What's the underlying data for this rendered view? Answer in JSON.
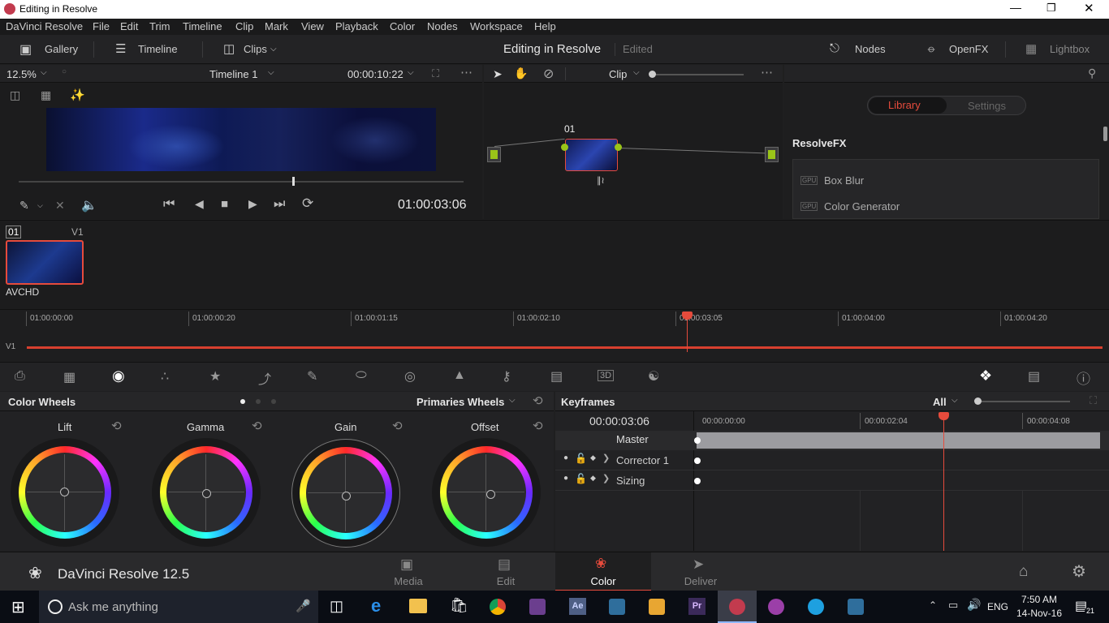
{
  "window": {
    "title": "Editing in Resolve"
  },
  "menu": [
    "DaVinci Resolve",
    "File",
    "Edit",
    "Trim",
    "Timeline",
    "Clip",
    "Mark",
    "View",
    "Playback",
    "Color",
    "Nodes",
    "Workspace",
    "Help"
  ],
  "toolbar": {
    "gallery": "Gallery",
    "timeline": "Timeline",
    "clips": "Clips",
    "project": "Editing in Resolve",
    "status": "Edited",
    "nodes": "Nodes",
    "openfx": "OpenFX",
    "lightbox": "Lightbox"
  },
  "viewer": {
    "zoom": "12.5%",
    "timeline_name": "Timeline 1",
    "duration": "00:00:10:22",
    "timecode": "01:00:03:06"
  },
  "nodegraph": {
    "mode": "Clip",
    "node_label": "01"
  },
  "fx": {
    "tab_library": "Library",
    "tab_settings": "Settings",
    "section": "ResolveFX",
    "items": [
      "Box Blur",
      "Color Generator"
    ],
    "badge": "GPU"
  },
  "clip": {
    "number": "01",
    "track": "V1",
    "codec": "AVCHD"
  },
  "timeline": {
    "ticks": [
      "01:00:00:00",
      "01:00:00:20",
      "01:00:01:15",
      "01:00:02:10",
      "01:00:03:05",
      "01:00:04:00",
      "01:00:04:20"
    ],
    "track": "V1"
  },
  "wheels": {
    "title": "Color Wheels",
    "mode": "Primaries Wheels",
    "labels": [
      "Lift",
      "Gamma",
      "Gain",
      "Offset"
    ]
  },
  "keyframes": {
    "title": "Keyframes",
    "filter": "All",
    "timecode": "00:00:03:06",
    "ticks": [
      "00:00:00:00",
      "00:00:02:04",
      "00:00:04:08"
    ],
    "rows": [
      "Master",
      "Corrector 1",
      "Sizing"
    ]
  },
  "app": {
    "name": "DaVinci Resolve 12.5"
  },
  "pages": [
    "Media",
    "Edit",
    "Color",
    "Deliver"
  ],
  "active_page": "Color",
  "taskbar": {
    "search": "Ask me anything",
    "lang": "ENG",
    "time": "7:50 AM",
    "date": "14-Nov-16",
    "notif": "21"
  },
  "colors": {
    "accent": "#e64b3c",
    "node_green": "#9ac419",
    "menu_bg": "#1a1a1b"
  }
}
